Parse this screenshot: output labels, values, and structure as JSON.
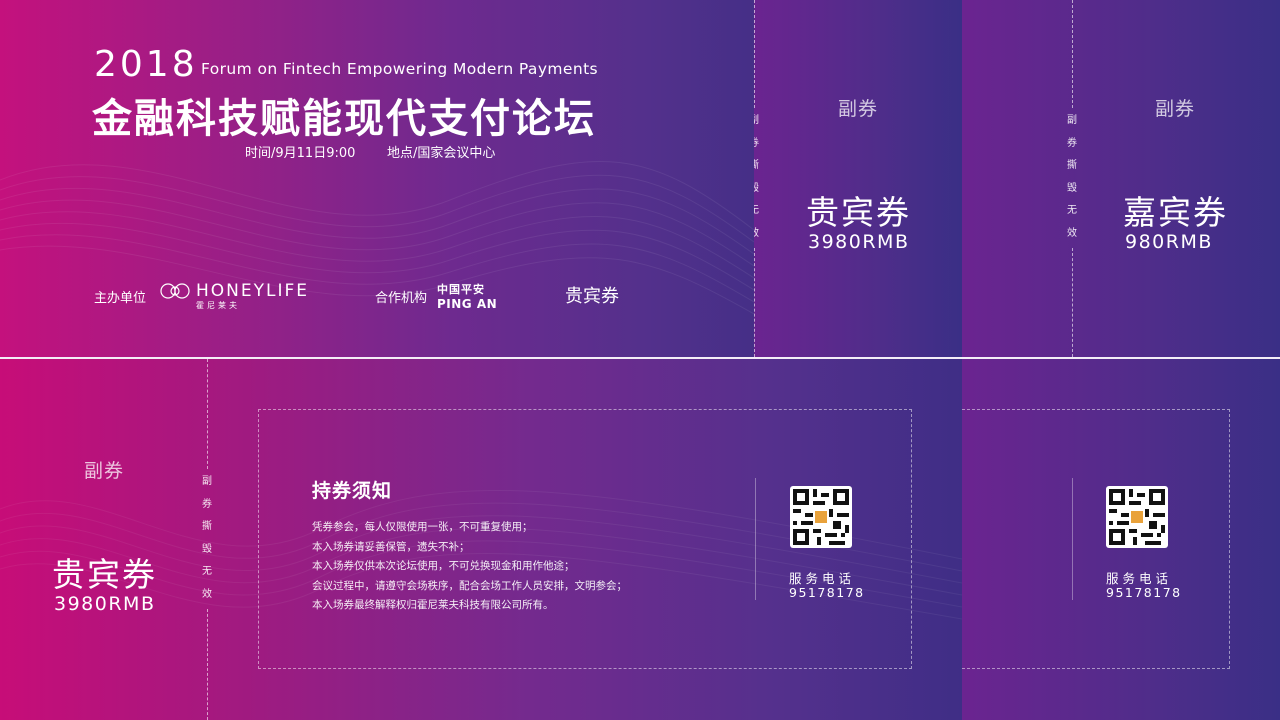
{
  "main_ticket": {
    "year": "2018",
    "subtitle_en": "Forum on Fintech Empowering Modern Payments",
    "title_cn": "金融科技赋能现代支付论坛",
    "time_text": "时间/9月11日9:00",
    "place_text": "地点/国家会议中心",
    "organizer_label": "主办单位",
    "organizer_logo_en": "HONEYLIFE",
    "organizer_logo_cn": "霍尼莱夫",
    "partner_label": "合作机构",
    "partner_logo_cn": "中国平安",
    "partner_logo_en": "PING AN",
    "ticket_type": "贵宾券"
  },
  "stubs": [
    {
      "label": "副券",
      "type": "贵宾券",
      "price": "3980RMB",
      "tear_text": [
        "副",
        "券",
        "撕",
        "毁",
        "无",
        "效"
      ]
    },
    {
      "label": "副券",
      "type": "嘉宾券",
      "price": "980RMB",
      "tear_text": [
        "副",
        "券",
        "撕",
        "毁",
        "无",
        "效"
      ]
    },
    {
      "label": "副券",
      "type": "贵宾券",
      "price": "3980RMB",
      "tear_text": [
        "副",
        "券",
        "撕",
        "毁",
        "无",
        "效"
      ]
    }
  ],
  "notice": {
    "title": "持券须知",
    "lines": [
      "凭券参会，每人仅限使用一张，不可重复使用；",
      "本入场券请妥善保管，遗失不补；",
      "本入场券仅供本次论坛使用，不可兑换现金和用作他途；",
      "会议过程中，请遵守会场秩序，配合会场工作人员安排，文明参会；",
      "本入场券最终解释权归霍尼莱夫科技有限公司所有。"
    ]
  },
  "service": {
    "label": "服务电话",
    "phone": "95178178"
  },
  "icons": {
    "qr": "qr-code-icon",
    "organizer": "honeylife-logo-icon",
    "partner": "pingan-logo-icon"
  }
}
